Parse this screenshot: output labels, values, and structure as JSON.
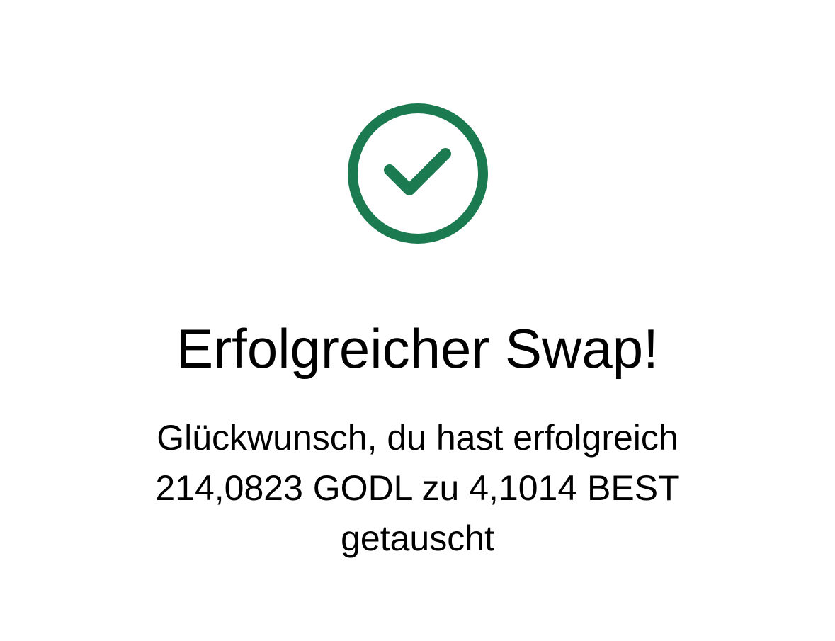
{
  "colors": {
    "accent": "#1b7a4f",
    "background": "#ffffff",
    "text": "#000000"
  },
  "icon": {
    "name": "check-circle-icon"
  },
  "title": "Erfolgreicher Swap!",
  "message": {
    "line1": "Glückwunsch, du hast erfolgreich",
    "line2": "214,0823 GODL zu 4,1014 BEST",
    "line3": "getauscht"
  }
}
